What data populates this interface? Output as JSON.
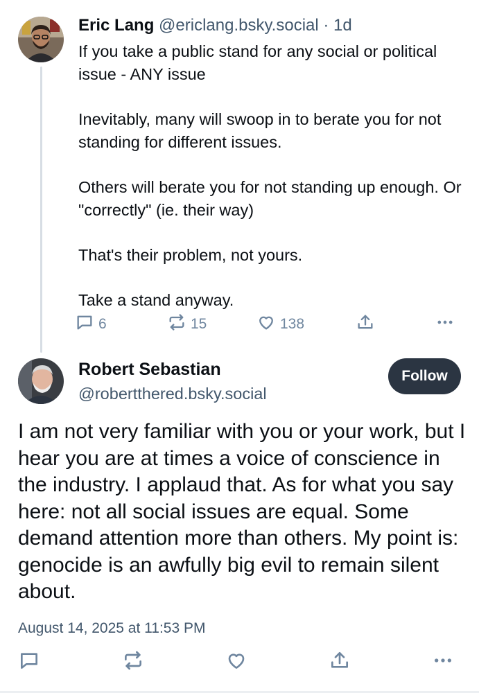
{
  "parent_post": {
    "author_name": "Eric Lang",
    "author_handle": "@ericlang.bsky.social",
    "separator": "·",
    "relative_time": "1d",
    "paragraphs": [
      "If you take a public stand for any social or political issue - ANY issue",
      "Inevitably, many will swoop in to berate you for not standing for different issues.",
      "Others will berate you for not standing up enough. Or \"correctly\" (ie. their way)",
      "That's their problem, not yours.",
      "Take a stand anyway."
    ],
    "counts": {
      "replies": "6",
      "reposts": "15",
      "likes": "138"
    }
  },
  "reply_post": {
    "author_name": "Robert Sebastian",
    "author_handle": "@robertthered.bsky.social",
    "follow_label": "Follow",
    "text": "I am not very familiar with you or your work, but I hear you are at times a voice of conscience in the industry. I applaud that. As for what you say here: not all social issues are equal. Some demand attention more than others. My point is: genocide is an awfully big evil to remain silent about.",
    "timestamp": "August 14, 2025 at 11:53 PM"
  },
  "icons": {
    "reply": "speech-bubble-icon",
    "repost": "repost-arrows-icon",
    "like": "heart-icon",
    "share": "share-upload-icon",
    "more": "ellipsis-icon"
  },
  "colors": {
    "text": "#0b0f14",
    "muted": "#42576c",
    "action_icon": "#6f869f",
    "follow_bg": "#2b3542",
    "thread_line": "#d7dde4"
  }
}
